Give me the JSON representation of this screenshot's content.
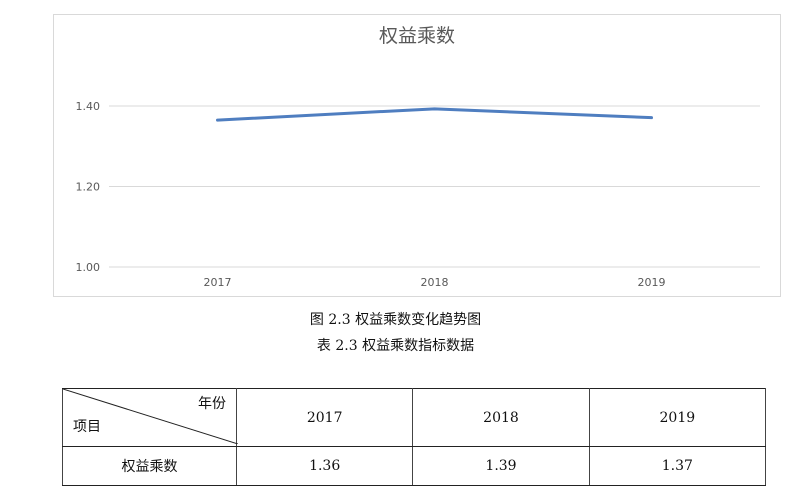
{
  "chart_data": {
    "type": "line",
    "title": "权益乘数",
    "categories": [
      "2017",
      "2018",
      "2019"
    ],
    "series": [
      {
        "values": [
          1.365,
          1.393,
          1.371
        ],
        "color": "#4f7ec0"
      }
    ],
    "yticks": [
      "1.00",
      "1.20",
      "1.40"
    ],
    "ylim": [
      1.0,
      1.4
    ],
    "grid": true
  },
  "figure_caption": "图 2.3 权益乘数变化趋势图",
  "table_caption": "表 2.3 权益乘数指标数据",
  "table": {
    "header_top": "年份",
    "header_bottom": "项目",
    "columns": [
      "2017",
      "2018",
      "2019"
    ],
    "row_label": "权益乘数",
    "row_values": [
      "1.36",
      "1.39",
      "1.37"
    ]
  }
}
